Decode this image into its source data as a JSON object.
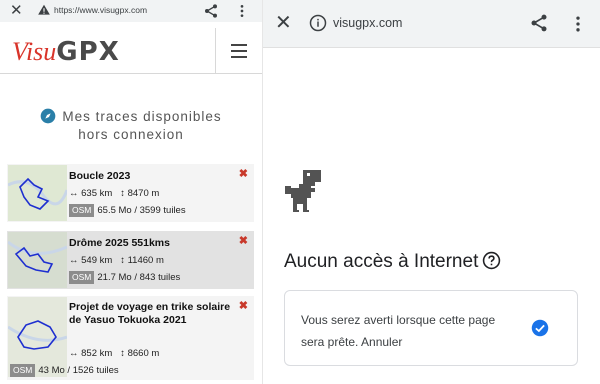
{
  "left_browser": {
    "url": "https://www.visugpx.com",
    "icons": [
      "close-icon",
      "warning-icon",
      "share-icon",
      "more-vert-icon"
    ]
  },
  "site": {
    "logo_part1": "Visu",
    "logo_part2": "GPX",
    "brand_color": "#d9342a",
    "offline_title_line1": "Mes traces disponibles",
    "offline_title_line2": "hors connexion"
  },
  "traces": [
    {
      "name": "Boucle 2023",
      "distance": "↔ 635 km",
      "elevation": "↕ 8470 m",
      "osm": "OSM",
      "size": "65.5 Mo / 3599 tuiles"
    },
    {
      "name": "Drôme 2025 551kms",
      "distance": "↔ 549 km",
      "elevation": "↕ 11460 m",
      "osm": "OSM",
      "size": "21.7 Mo / 843 tuiles"
    },
    {
      "name": "Projet de voyage en trike solaire de Yasuo Tokuoka 2021",
      "distance": "↔ 852 km",
      "elevation": "↕ 8660 m",
      "osm": "OSM",
      "size": "43 Mo / 1526 tuiles"
    }
  ],
  "delete_glyph": "✖",
  "right_browser": {
    "url": "visugpx.com",
    "icons": [
      "close-icon",
      "info-icon",
      "share-icon",
      "more-vert-icon"
    ]
  },
  "offline_page": {
    "title": "Aucun accès à Internet",
    "notify_message": "Vous serez averti lorsque cette page sera prête. Annuler",
    "accent_color": "#1a73e8"
  }
}
